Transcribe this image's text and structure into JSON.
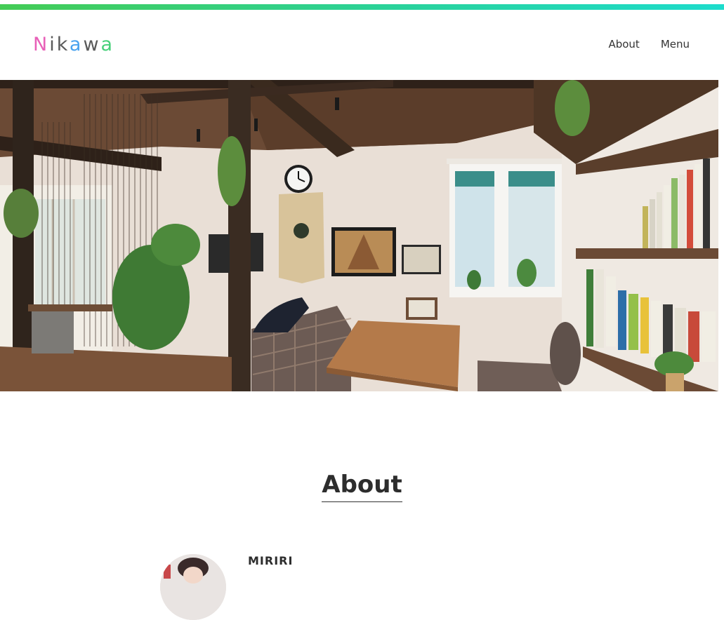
{
  "header": {
    "logo_letters": [
      "N",
      "i",
      "k",
      "a",
      "w",
      "a"
    ],
    "nav": [
      {
        "label": "About"
      },
      {
        "label": "Menu"
      }
    ]
  },
  "hero": {
    "image_description_icon": "cafe-interior-photo"
  },
  "about": {
    "title": "About",
    "profile_name": "MIRIRI"
  },
  "colors": {
    "gradient_start": "#44cc55",
    "gradient_end": "#1ddccc",
    "logo_pink": "#e860b8",
    "logo_blue": "#4aa3ef",
    "logo_green": "#47d07a"
  }
}
